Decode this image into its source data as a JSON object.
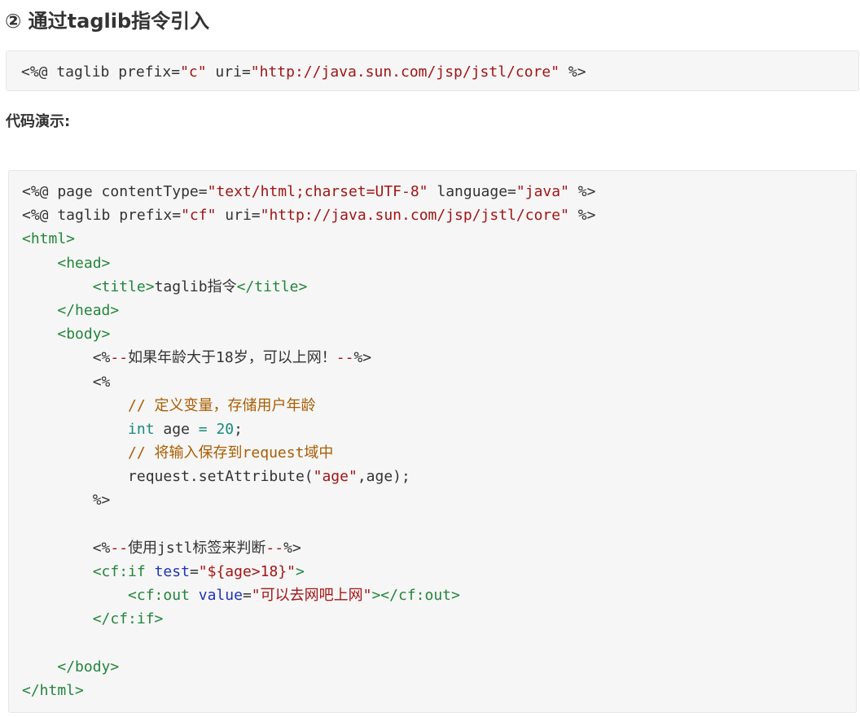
{
  "heading": "② 通过taglib指令引入",
  "snippet1": [
    [
      [
        "plain",
        "<%@ taglib prefix="
      ],
      [
        "str",
        "\"c\""
      ],
      [
        "plain",
        " uri="
      ],
      [
        "str",
        "\"http://java.sun.com/jsp/jstl/core\""
      ],
      [
        "plain",
        " %>"
      ]
    ]
  ],
  "demo_label": "代码演示:",
  "snippet2": [
    [
      [
        "plain",
        "<%@ page contentType="
      ],
      [
        "str",
        "\"text/html;charset=UTF-8\""
      ],
      [
        "plain",
        " language="
      ],
      [
        "str",
        "\"java\""
      ],
      [
        "plain",
        " %>"
      ]
    ],
    [
      [
        "plain",
        "<%@ taglib prefix="
      ],
      [
        "str",
        "\"cf\""
      ],
      [
        "plain",
        " uri="
      ],
      [
        "str",
        "\"http://java.sun.com/jsp/jstl/core\""
      ],
      [
        "plain",
        " %>"
      ]
    ],
    [
      [
        "tag",
        "<html>"
      ]
    ],
    [
      [
        "plain",
        "    "
      ],
      [
        "tag",
        "<head>"
      ]
    ],
    [
      [
        "plain",
        "        "
      ],
      [
        "tag",
        "<title>"
      ],
      [
        "plain",
        "taglib指令"
      ],
      [
        "tag",
        "</title>"
      ]
    ],
    [
      [
        "plain",
        "    "
      ],
      [
        "tag",
        "</head>"
      ]
    ],
    [
      [
        "plain",
        "    "
      ],
      [
        "tag",
        "<body>"
      ]
    ],
    [
      [
        "plain",
        "        <%"
      ],
      [
        "jspc",
        "--"
      ],
      [
        "plain",
        "如果年龄大于18岁，可以上网！"
      ],
      [
        "jspc",
        "--"
      ],
      [
        "plain",
        "%>"
      ]
    ],
    [
      [
        "plain",
        "        <%"
      ]
    ],
    [
      [
        "plain",
        "            "
      ],
      [
        "comment",
        "// 定义变量，存储用户年龄"
      ]
    ],
    [
      [
        "plain",
        "            "
      ],
      [
        "kw",
        "int"
      ],
      [
        "plain",
        " age "
      ],
      [
        "kw",
        "="
      ],
      [
        "plain",
        " "
      ],
      [
        "num",
        "20"
      ],
      [
        "plain",
        ";"
      ]
    ],
    [
      [
        "plain",
        "            "
      ],
      [
        "comment",
        "// 将输入保存到request域中"
      ]
    ],
    [
      [
        "plain",
        "            request.setAttribute("
      ],
      [
        "str",
        "\"age\""
      ],
      [
        "plain",
        ",age);"
      ]
    ],
    [
      [
        "plain",
        "        %>"
      ]
    ],
    [
      [
        "plain",
        ""
      ]
    ],
    [
      [
        "plain",
        "        <%"
      ],
      [
        "jspc",
        "--"
      ],
      [
        "plain",
        "使用jstl标签来判断"
      ],
      [
        "jspc",
        "--"
      ],
      [
        "plain",
        "%>"
      ]
    ],
    [
      [
        "plain",
        "        "
      ],
      [
        "tag",
        "<cf:if"
      ],
      [
        "plain",
        " "
      ],
      [
        "attr",
        "test"
      ],
      [
        "plain",
        "="
      ],
      [
        "str",
        "\"${age>18}\""
      ],
      [
        "tag",
        ">"
      ]
    ],
    [
      [
        "plain",
        "            "
      ],
      [
        "tag",
        "<cf:out"
      ],
      [
        "plain",
        " "
      ],
      [
        "attr",
        "value"
      ],
      [
        "plain",
        "="
      ],
      [
        "str",
        "\"可以去网吧上网\""
      ],
      [
        "tag",
        "></cf:out>"
      ]
    ],
    [
      [
        "plain",
        "        "
      ],
      [
        "tag",
        "</cf:if>"
      ]
    ],
    [
      [
        "plain",
        ""
      ]
    ],
    [
      [
        "plain",
        "    "
      ],
      [
        "tag",
        "</body>"
      ]
    ],
    [
      [
        "tag",
        "</html>"
      ]
    ]
  ]
}
